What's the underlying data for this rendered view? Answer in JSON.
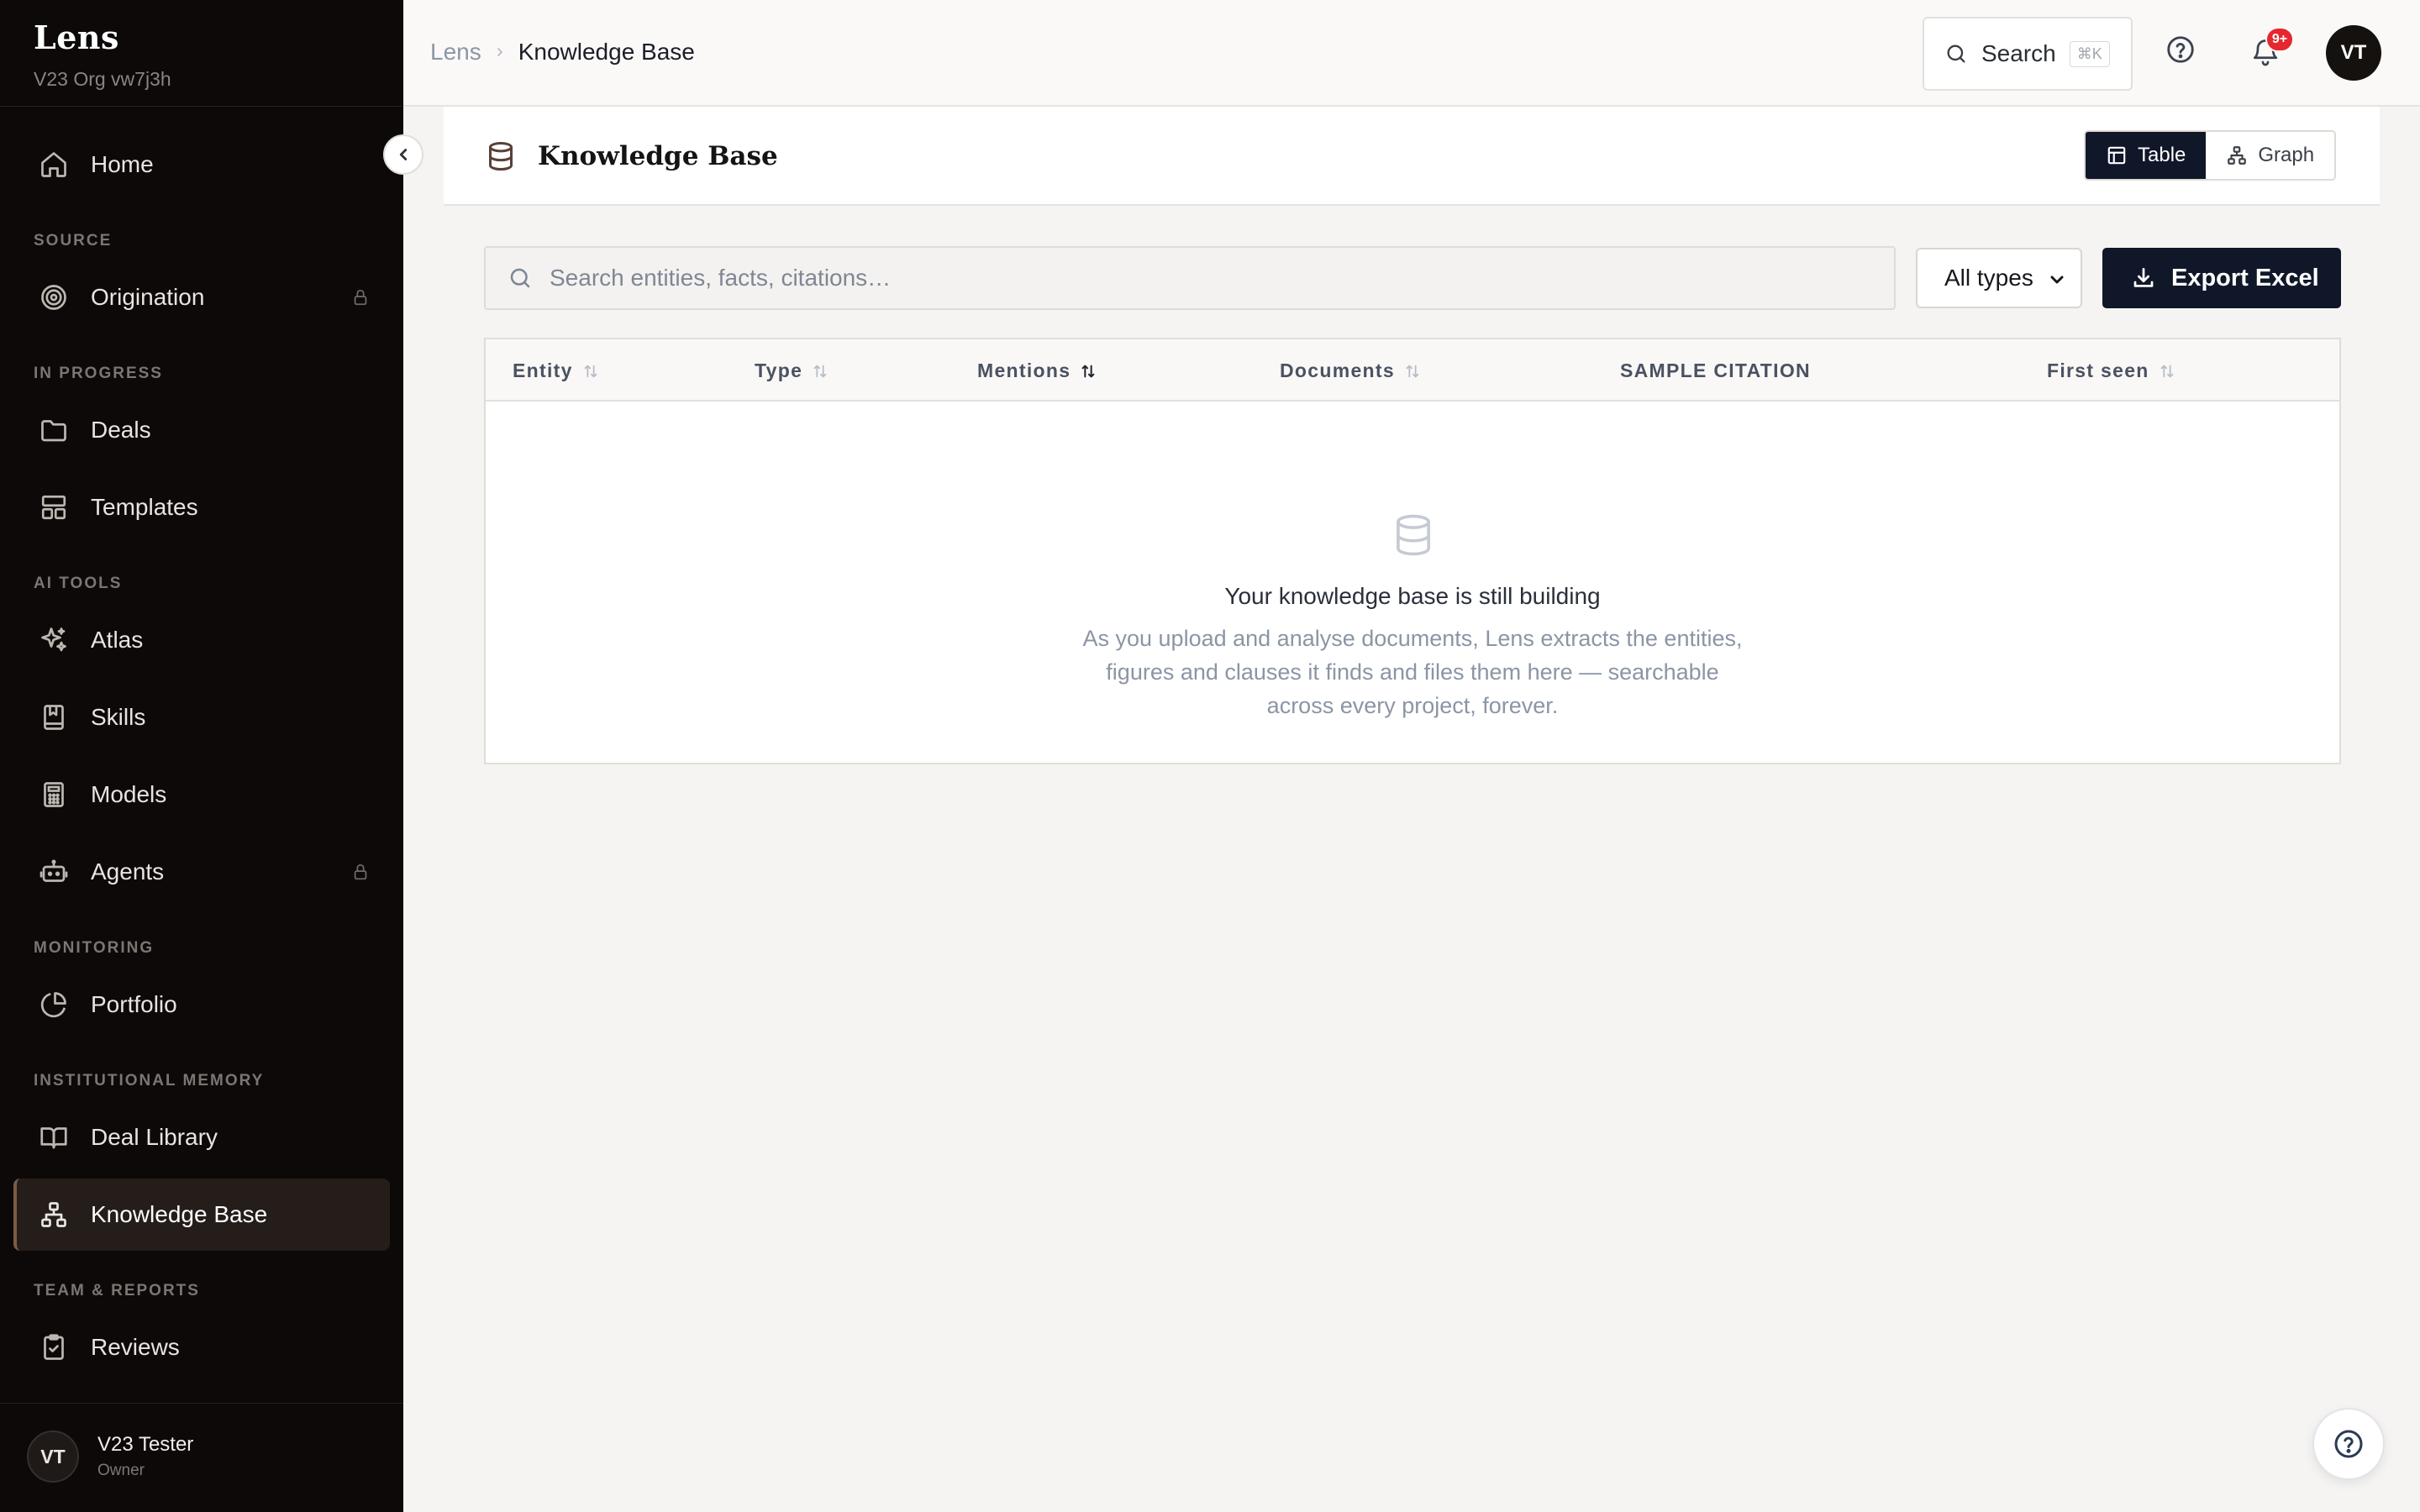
{
  "app": {
    "name": "Lens",
    "org": "V23 Org vw7j3h"
  },
  "sidebar": {
    "sections": [
      {
        "label": "SOURCE"
      },
      {
        "label": "IN PROGRESS"
      },
      {
        "label": "AI TOOLS"
      },
      {
        "label": "MONITORING"
      },
      {
        "label": "INSTITUTIONAL MEMORY"
      },
      {
        "label": "TEAM & REPORTS"
      }
    ],
    "items": [
      {
        "label": "Home",
        "icon": "home-icon"
      },
      {
        "label": "Origination",
        "icon": "target-icon",
        "locked": true
      },
      {
        "label": "Deals",
        "icon": "folder-icon"
      },
      {
        "label": "Templates",
        "icon": "layout-icon"
      },
      {
        "label": "Atlas",
        "icon": "sparkles-icon"
      },
      {
        "label": "Skills",
        "icon": "bookmark-book-icon"
      },
      {
        "label": "Models",
        "icon": "calculator-icon"
      },
      {
        "label": "Agents",
        "icon": "bot-icon",
        "locked": true
      },
      {
        "label": "Portfolio",
        "icon": "pie-chart-icon"
      },
      {
        "label": "Deal Library",
        "icon": "open-book-icon"
      },
      {
        "label": "Knowledge Base",
        "icon": "network-icon",
        "active": true
      },
      {
        "label": "Reviews",
        "icon": "clipboard-check-icon"
      }
    ],
    "user": {
      "initials": "VT",
      "name": "V23 Tester",
      "role": "Owner"
    }
  },
  "topbar": {
    "breadcrumb": {
      "root": "Lens",
      "current": "Knowledge Base"
    },
    "search_label": "Search",
    "search_shortcut": "⌘K",
    "notification_count": "9+",
    "user_initials": "VT"
  },
  "page": {
    "title": "Knowledge Base",
    "view_toggle": {
      "table": "Table",
      "graph": "Graph",
      "active": "table"
    },
    "search": {
      "placeholder": "Search entities, facts, citations…",
      "value": ""
    },
    "type_filter": {
      "selected": "All types",
      "options": [
        "All types"
      ]
    },
    "export_label": "Export Excel",
    "table": {
      "columns": [
        {
          "label": "Entity",
          "sortable": true
        },
        {
          "label": "Type",
          "sortable": true
        },
        {
          "label": "Mentions",
          "sortable": true,
          "sorted": true
        },
        {
          "label": "Documents",
          "sortable": true
        },
        {
          "label": "SAMPLE CITATION",
          "sortable": false
        },
        {
          "label": "First seen",
          "sortable": true
        }
      ],
      "rows": []
    },
    "empty_state": {
      "title": "Your knowledge base is still building",
      "description": "As you upload and analyse documents, Lens extracts the entities, figures and clauses it finds and files them here — searchable across every project, forever."
    }
  },
  "colors": {
    "sidebar_bg": "#0c0908",
    "primary": "#0f1728",
    "badge": "#e5272f",
    "active_nav_accent": "#7c5c47"
  }
}
